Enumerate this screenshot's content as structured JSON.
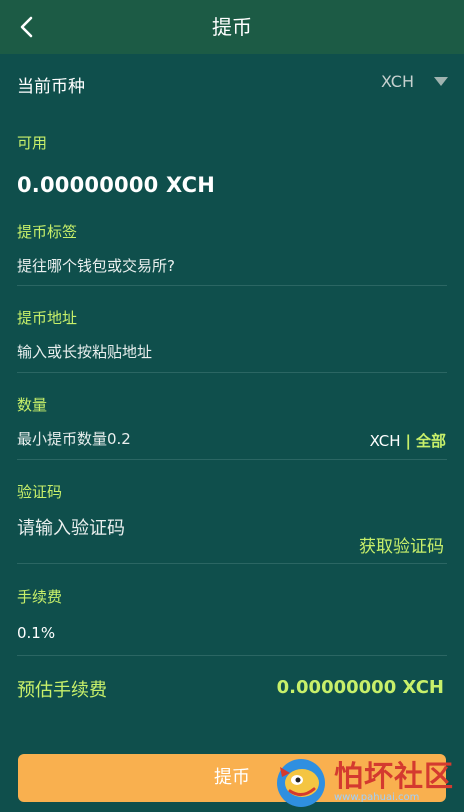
{
  "header": {
    "title": "提币",
    "back_icon": "chevron-left-icon"
  },
  "coin": {
    "label": "当前币种",
    "selected": "XCH",
    "dropdown_icon": "caret-down-icon"
  },
  "available": {
    "label": "可用",
    "value": "0.00000000 XCH"
  },
  "tag": {
    "label": "提币标签",
    "placeholder": "提往哪个钱包或交易所?"
  },
  "address": {
    "label": "提币地址",
    "placeholder": "输入或长按粘贴地址"
  },
  "amount": {
    "label": "数量",
    "placeholder": "最小提币数量0.2",
    "unit": "XCH",
    "separator": "|",
    "all_label": "全部"
  },
  "code": {
    "label": "验证码",
    "placeholder": "请输入验证码",
    "get_code_label": "获取验证码"
  },
  "fee": {
    "label": "手续费",
    "value": "0.1%"
  },
  "estimated_fee": {
    "label": "预估手续费",
    "value": "0.00000000 XCH"
  },
  "submit_label": "提币",
  "watermark": {
    "name": "怕坏社区",
    "url": "www.pahuai.com"
  },
  "colors": {
    "background": "#0f4f4c",
    "header": "#1c5b45",
    "accent": "#c8f06a",
    "button": "#f9b04f"
  }
}
